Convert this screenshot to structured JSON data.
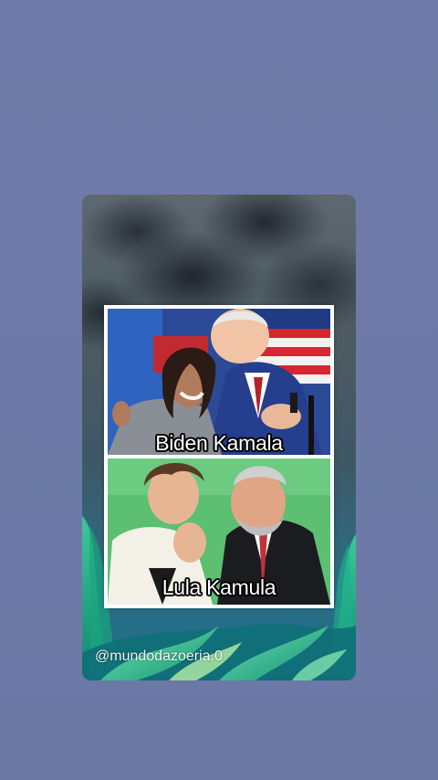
{
  "story": {
    "background_color": "#6e7ba8",
    "meme": {
      "top_caption": "Biden Kamala",
      "bottom_caption": "Lula Kamula"
    },
    "watermark": "@mundodazoeria.0"
  }
}
